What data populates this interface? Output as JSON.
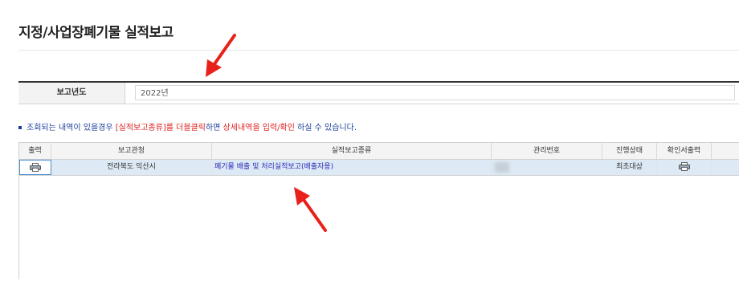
{
  "page": {
    "title": "지정/사업장폐기물 실적보고"
  },
  "search": {
    "year_label": "보고년도",
    "year_value": "2022년"
  },
  "notice": {
    "part1": "조회되는 내역이 있을경우 ",
    "highlight1": "[실적보고종류]",
    "part2": "를 더블클릭",
    "part3": "하면 ",
    "highlight2": "상세내역을 입력/확인",
    "part4": " 하실 수 있습니다."
  },
  "grid": {
    "columns": [
      "출력",
      "보고관청",
      "실적보고종류",
      "관리번호",
      "진행상태",
      "확인서출력"
    ],
    "rows": [
      {
        "office": "전라북도 익산시",
        "report_type": "폐기물 배출 및 처리실적보고(배출자용)",
        "mgmt_no": "",
        "status": "최초대상"
      }
    ]
  },
  "colors": {
    "accent_red": "#e02020",
    "notice_blue": "#1a3f9a",
    "row_highlight": "#dde9f4",
    "annotation_arrow": "#e8221a"
  },
  "icons": {
    "print": "printer-icon"
  }
}
